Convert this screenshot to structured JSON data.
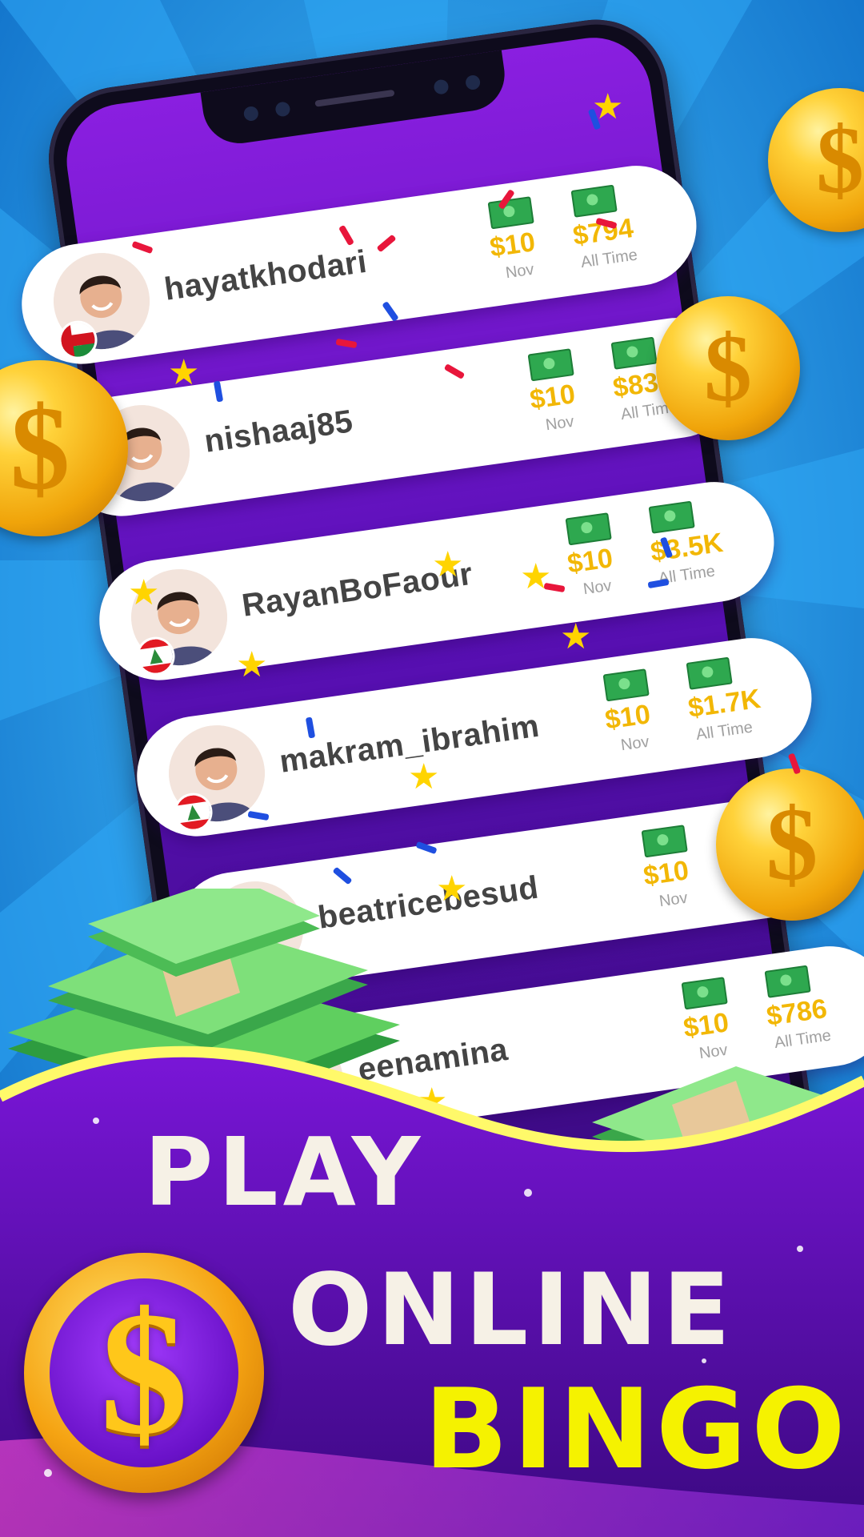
{
  "leaderboard": [
    {
      "username": "hayatkhodari",
      "month_amount": "$10",
      "month_label": "Nov",
      "alltime_amount": "$794",
      "alltime_label": "All Time",
      "flag": "oman-flag"
    },
    {
      "username": "nishaaj85",
      "month_amount": "$10",
      "month_label": "Nov",
      "alltime_amount": "$834",
      "alltime_label": "All Time",
      "flag": ""
    },
    {
      "username": "RayanBoFaour",
      "month_amount": "$10",
      "month_label": "Nov",
      "alltime_amount": "$3.5K",
      "alltime_label": "All Time",
      "flag": "lebanon-flag"
    },
    {
      "username": "makram_ibrahim",
      "month_amount": "$10",
      "month_label": "Nov",
      "alltime_amount": "$1.7K",
      "alltime_label": "All Time",
      "flag": "lebanon-flag"
    },
    {
      "username": "beatricebesud",
      "month_amount": "$10",
      "month_label": "Nov",
      "alltime_amount": "",
      "alltime_label": "",
      "flag": ""
    },
    {
      "username": "eenamina",
      "month_amount": "$10",
      "month_label": "Nov",
      "alltime_amount": "$786",
      "alltime_label": "All Time",
      "flag": ""
    }
  ],
  "headline": {
    "line1": "PLAY",
    "line2": "ONLINE",
    "line3": "BINGO"
  },
  "badge_symbol": "$",
  "coin_symbol": "$",
  "icons": [
    "dollar-coin-icon",
    "money-bill-icon",
    "star-icon",
    "cash-stack-icon",
    "dollar-badge-icon"
  ],
  "colors": {
    "sky_blue": "#1a8fe6",
    "purple": "#6a12c9",
    "gold": "#f2b705",
    "bingo_yellow": "#f5f200",
    "title_cream": "#f6f1e6"
  }
}
